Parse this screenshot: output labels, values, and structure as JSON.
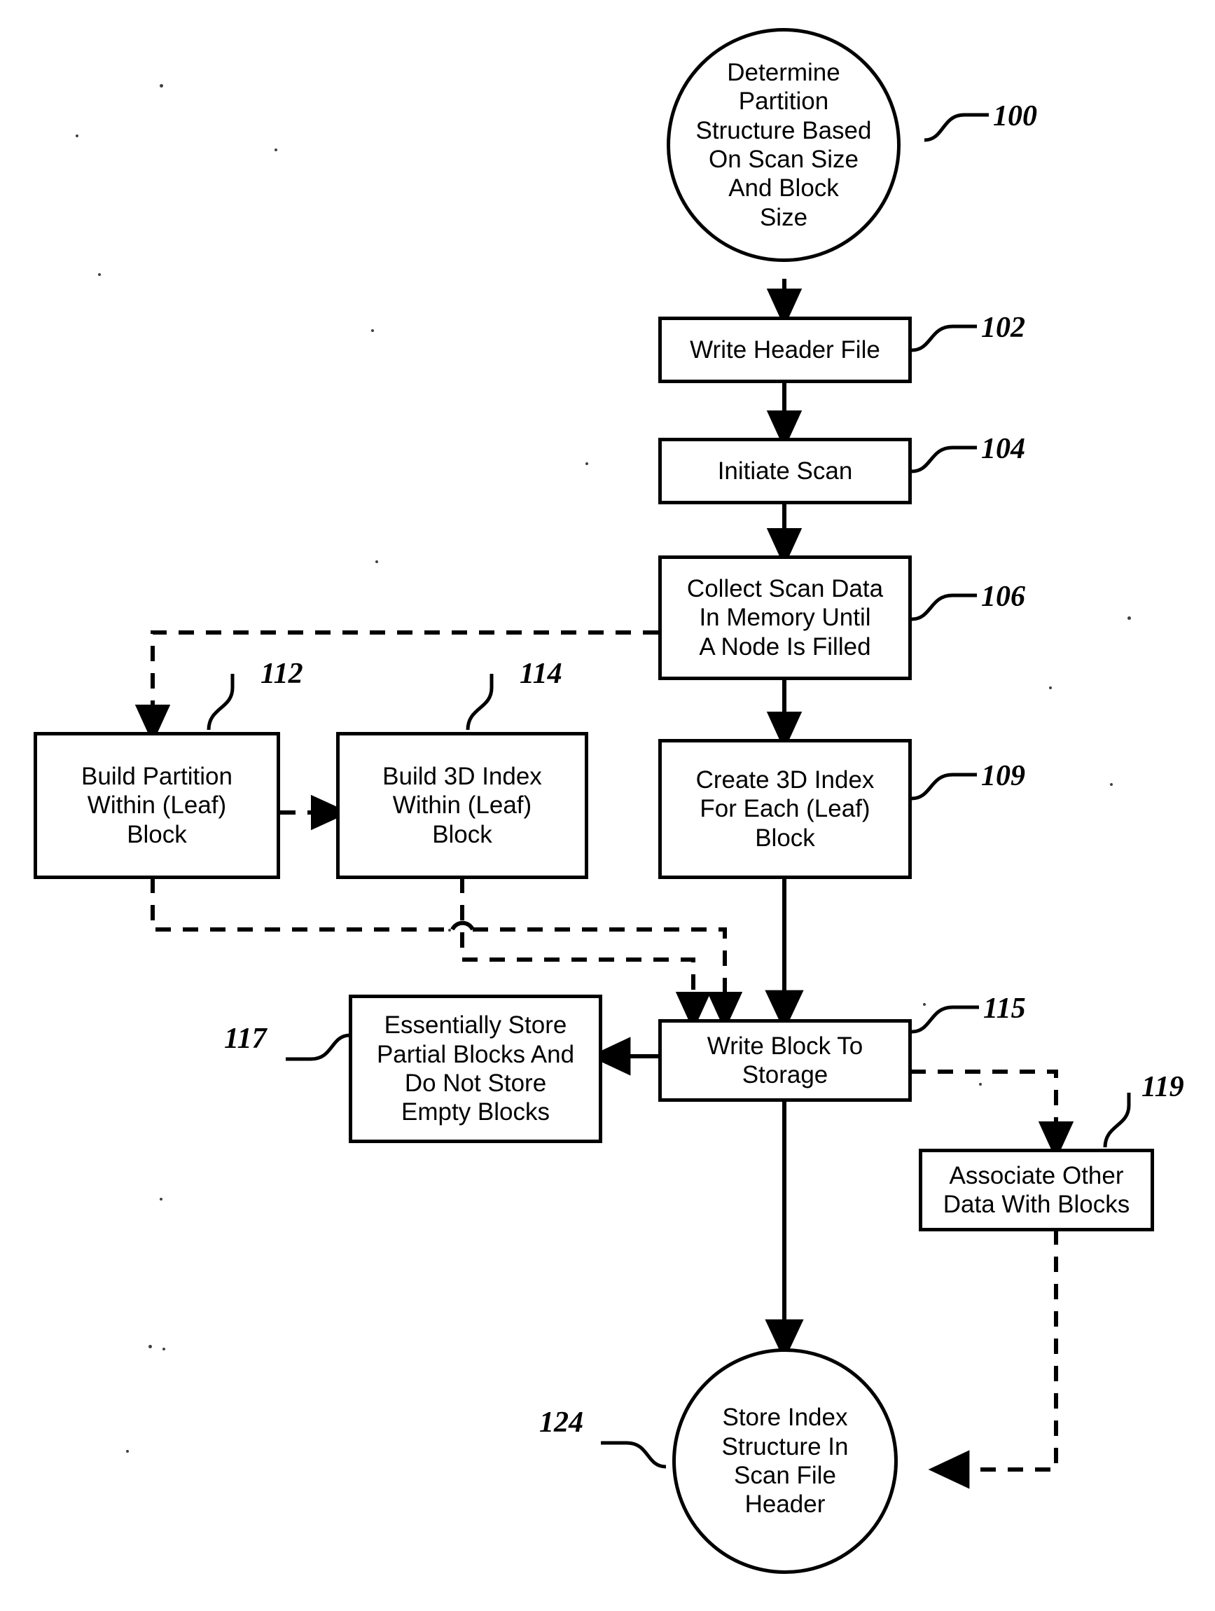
{
  "figure": {
    "type": "process-flowchart",
    "background_color": "#ffffff",
    "line_color": "#000000"
  },
  "nodes": [
    {
      "id": "n100",
      "shape": "circle",
      "text": "Determine\nPartition\nStructure Based\nOn Scan Size\nAnd Block\nSize",
      "ref": "100"
    },
    {
      "id": "n102",
      "shape": "box",
      "text": "Write Header File",
      "ref": "102"
    },
    {
      "id": "n104",
      "shape": "box",
      "text": "Initiate Scan",
      "ref": "104"
    },
    {
      "id": "n106",
      "shape": "box",
      "text": "Collect Scan Data\nIn Memory Until\nA Node Is Filled",
      "ref": "106"
    },
    {
      "id": "n112",
      "shape": "box",
      "text": "Build Partition\nWithin (Leaf)\nBlock",
      "ref": "112"
    },
    {
      "id": "n114",
      "shape": "box",
      "text": "Build 3D Index\nWithin (Leaf)\nBlock",
      "ref": "114"
    },
    {
      "id": "n109",
      "shape": "box",
      "text": "Create 3D Index\nFor Each (Leaf)\nBlock",
      "ref": "109"
    },
    {
      "id": "n117",
      "shape": "box",
      "text": "Essentially Store\nPartial Blocks And\nDo Not Store\nEmpty Blocks",
      "ref": "117"
    },
    {
      "id": "n115",
      "shape": "box",
      "text": "Write Block To\nStorage",
      "ref": "115"
    },
    {
      "id": "n119",
      "shape": "box",
      "text": "Associate Other\nData With Blocks",
      "ref": "119"
    },
    {
      "id": "n124",
      "shape": "circle",
      "text": "Store Index\nStructure In\nScan File\nHeader",
      "ref": "124"
    }
  ],
  "reference_numbers": [
    "100",
    "102",
    "104",
    "106",
    "112",
    "114",
    "109",
    "117",
    "115",
    "119",
    "124"
  ],
  "connections": [
    {
      "from": "n100",
      "to": "n102",
      "style": "solid",
      "arrow": true
    },
    {
      "from": "n102",
      "to": "n104",
      "style": "solid",
      "arrow": true
    },
    {
      "from": "n104",
      "to": "n106",
      "style": "solid",
      "arrow": true
    },
    {
      "from": "n106",
      "to": "n109",
      "style": "solid",
      "arrow": true
    },
    {
      "from": "n106",
      "to": "n112",
      "style": "dashed",
      "arrow": true
    },
    {
      "from": "n112",
      "to": "n114",
      "style": "dashed",
      "arrow": true
    },
    {
      "from": "n112",
      "to": "n115",
      "style": "dashed",
      "arrow": true
    },
    {
      "from": "n114",
      "to": "n115",
      "style": "dashed",
      "arrow": true
    },
    {
      "from": "n109",
      "to": "n115",
      "style": "solid",
      "arrow": true
    },
    {
      "from": "n115",
      "to": "n117",
      "style": "solid",
      "arrow": true
    },
    {
      "from": "n115",
      "to": "n119",
      "style": "dashed",
      "arrow": true
    },
    {
      "from": "n115",
      "to": "n124",
      "style": "solid",
      "arrow": true
    },
    {
      "from": "n119",
      "to": "n124",
      "style": "dashed",
      "arrow": true
    }
  ]
}
